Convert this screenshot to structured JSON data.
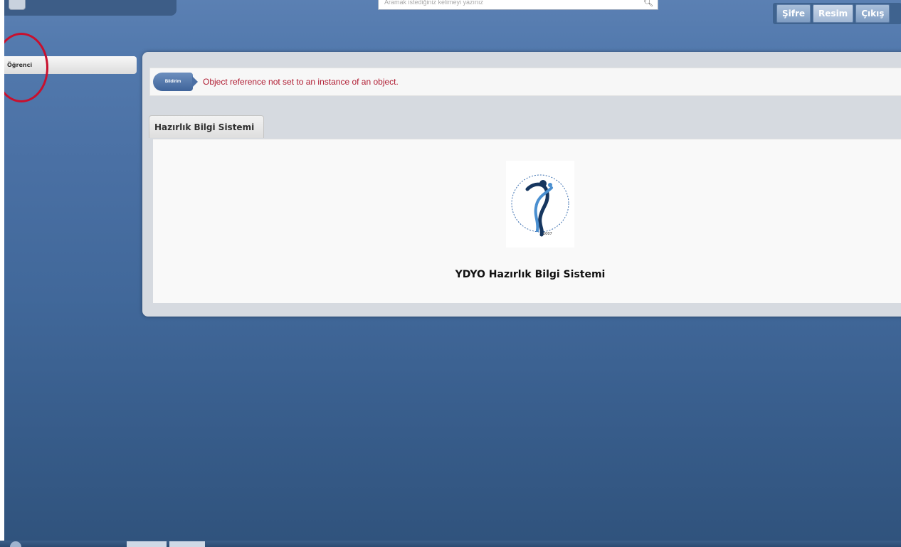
{
  "search": {
    "placeholder": "Aramak istediğiniz kelimeyi yazınız"
  },
  "toolbar": {
    "buttons": [
      {
        "label": "Şifre"
      },
      {
        "label": "Resim"
      },
      {
        "label": "Çıkış"
      }
    ]
  },
  "sidebar": {
    "items": [
      {
        "label": "Öğrenci"
      }
    ]
  },
  "message": {
    "badge": "Bildirim",
    "text": "Object reference not set to an instance of an object."
  },
  "tabs": [
    {
      "label": "Hazırlık Bilgi Sistemi"
    }
  ],
  "content": {
    "logo": "pamukkale-university-ydyo-seal",
    "title": "YDYO Hazırlık Bilgi Sistemi"
  },
  "colors": {
    "background_top": "#5b80b3",
    "background_bottom": "#30537d",
    "error_text": "#b01c32",
    "annotation_circle": "#c8102e"
  }
}
